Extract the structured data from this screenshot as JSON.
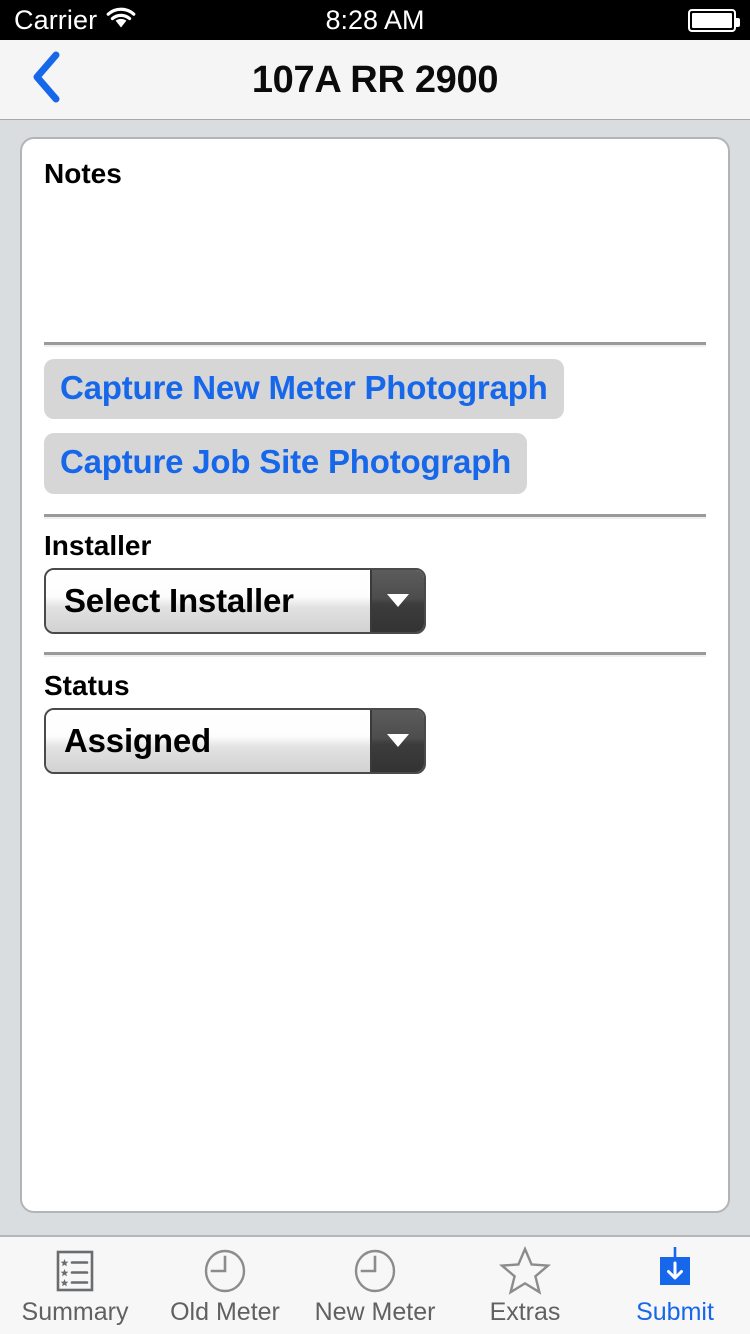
{
  "status_bar": {
    "carrier": "Carrier",
    "time": "8:28 AM",
    "wifi_icon": "wifi-icon",
    "battery_icon": "battery-full-icon"
  },
  "nav_bar": {
    "title": "107A RR 2900",
    "back_icon": "chevron-left-icon"
  },
  "form": {
    "notes": {
      "label": "Notes",
      "value": "",
      "placeholder": ""
    },
    "capture_new_meter_button": "Capture New Meter Photograph",
    "capture_job_site_button": "Capture Job Site Photograph",
    "installer": {
      "label": "Installer",
      "value": "Select Installer",
      "dropdown_icon": "caret-down-icon"
    },
    "status": {
      "label": "Status",
      "value": "Assigned",
      "dropdown_icon": "caret-down-icon"
    }
  },
  "tab_bar": {
    "active_index": 4,
    "items": [
      {
        "label": "Summary",
        "icon": "list-star-icon"
      },
      {
        "label": "Old Meter",
        "icon": "clock-icon"
      },
      {
        "label": "New Meter",
        "icon": "clock-icon"
      },
      {
        "label": "Extras",
        "icon": "star-icon"
      },
      {
        "label": "Submit",
        "icon": "submit-download-icon"
      }
    ]
  },
  "colors": {
    "accent_blue": "#1667ea",
    "page_background": "#d9dde0",
    "card_background": "#ffffff",
    "status_bar_background": "#000000",
    "nav_bar_background": "#f5f5f5",
    "tab_bar_background": "#f7f7f7",
    "button_background": "#d6d6d6",
    "tab_label_gray": "#5f6163"
  }
}
